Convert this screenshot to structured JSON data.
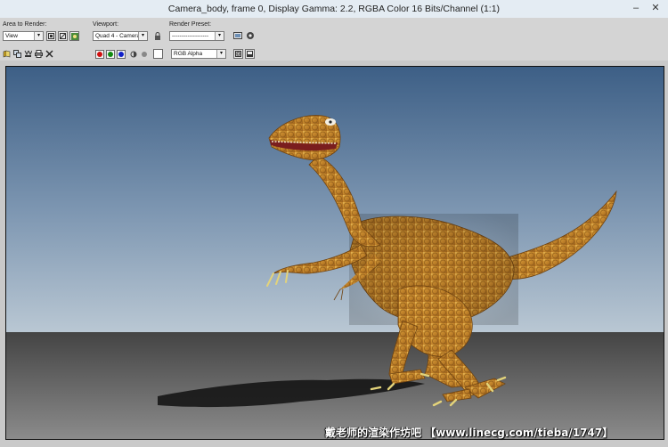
{
  "window": {
    "title": "Camera_body, frame 0, Display Gamma: 2.2, RGBA Color 16 Bits/Channel (1:1)",
    "minimize_glyph": "–",
    "close_glyph": "✕"
  },
  "toolbar": {
    "area_label": "Area to Render:",
    "area_value": "View",
    "viewport_label": "Viewport:",
    "viewport_value": "Quad 4 - Camera_",
    "preset_label": "Render Preset:",
    "preset_value": "-------------------",
    "channel_value": "RGB Alpha",
    "channel_colors": {
      "red": "#d01010",
      "green": "#108a10",
      "blue": "#1020c8"
    }
  },
  "watermark": "戴老师的渲染作坊吧 【www.linecg.com/tieba/1747】",
  "colors": {
    "sky_top": "#3d5f86",
    "sky_bottom": "#b9c7d3",
    "ground_top": "#444444",
    "ground_bottom": "#8b8b8b",
    "dino_skin": "#c98c2c"
  }
}
